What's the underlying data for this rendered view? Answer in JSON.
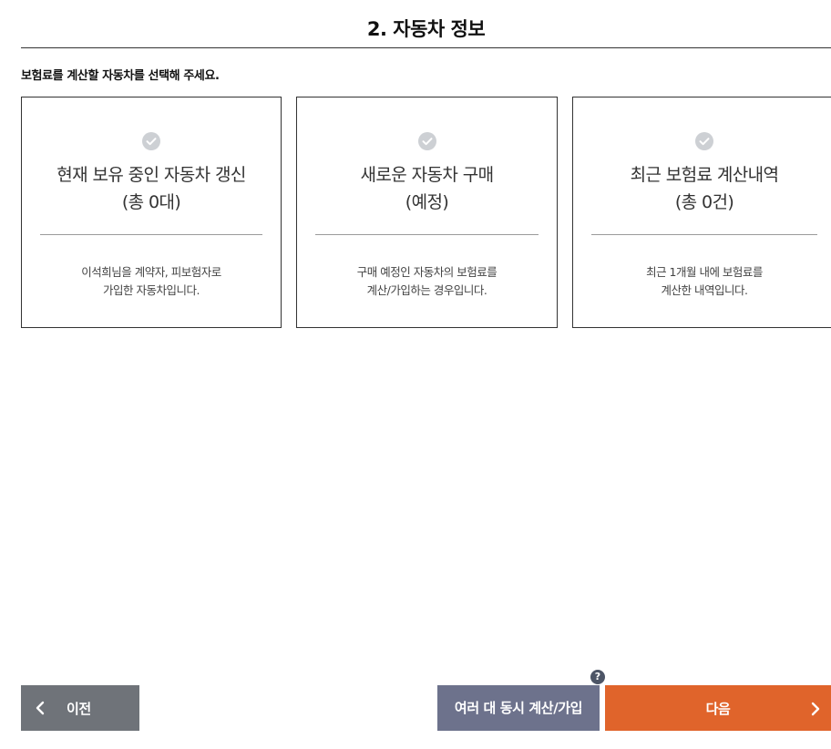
{
  "header": {
    "title": "2. 자동차 정보",
    "instruction": "보험료를 계산할 자동차를 선택해 주세요."
  },
  "cards": [
    {
      "title": "현재 보유 중인 자동차 갱신",
      "subtitle": "(총 0대)",
      "desc_line1": "이석희님을 계약자, 피보험자로",
      "desc_line2": "가입한 자동차입니다.",
      "icon": "check-circle-icon"
    },
    {
      "title": "새로운 자동차 구매",
      "subtitle": "(예정)",
      "desc_line1": "구매 예정인 자동차의 보험료를",
      "desc_line2": "계산/가입하는 경우입니다.",
      "icon": "check-circle-icon"
    },
    {
      "title": "최근 보험료 계산내역",
      "subtitle": "(총 0건)",
      "desc_line1": "최근 1개월 내에 보험료를",
      "desc_line2": "계산한 내역입니다.",
      "icon": "check-circle-icon"
    }
  ],
  "footer": {
    "prev_label": "이전",
    "multi_label": "여러 대 동시 계산/가입",
    "help_label": "?",
    "next_label": "다음"
  },
  "colors": {
    "prev_button": "#6f7379",
    "multi_button": "#6d728c",
    "next_button": "#e0642b",
    "check_icon": "#cdd0d4",
    "help_icon": "#4d5566"
  }
}
